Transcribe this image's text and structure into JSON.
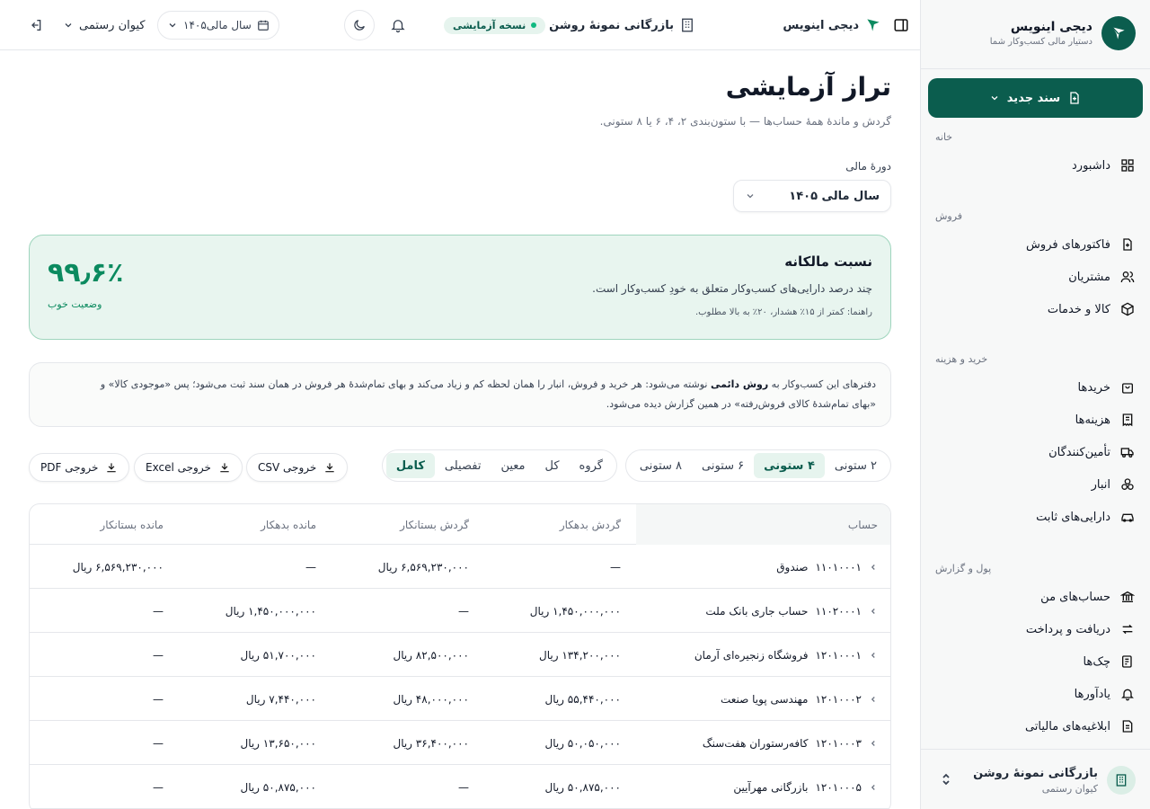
{
  "sidebar": {
    "brand_name": "دیجی اینویس",
    "brand_tagline": "دستیار مالی کسب‌وکار شما",
    "new_doc_label": "سند جدید",
    "sections": [
      {
        "title": "خانه",
        "items": [
          {
            "label": "داشبورد",
            "icon": "grid-icon"
          }
        ]
      },
      {
        "title": "فروش",
        "items": [
          {
            "label": "فاکتورهای فروش",
            "icon": "invoice-icon"
          },
          {
            "label": "مشتریان",
            "icon": "users-icon"
          },
          {
            "label": "کالا و خدمات",
            "icon": "box-icon"
          }
        ]
      },
      {
        "title": "خرید و هزینه",
        "items": [
          {
            "label": "خریدها",
            "icon": "bag-icon"
          },
          {
            "label": "هزینه‌ها",
            "icon": "receipt-icon"
          },
          {
            "label": "تأمین‌کنندگان",
            "icon": "truck-icon"
          },
          {
            "label": "انبار",
            "icon": "boxes-icon"
          },
          {
            "label": "دارایی‌های ثابت",
            "icon": "car-icon"
          }
        ]
      },
      {
        "title": "پول و گزارش",
        "items": [
          {
            "label": "حساب‌های من",
            "icon": "bank-icon"
          },
          {
            "label": "دریافت و پرداخت",
            "icon": "arrows-icon"
          },
          {
            "label": "چک‌ها",
            "icon": "cheque-icon"
          },
          {
            "label": "یادآورها",
            "icon": "bell-icon"
          },
          {
            "label": "ابلاغیه‌های مالیاتی",
            "icon": "mail-icon"
          }
        ]
      }
    ],
    "org_name": "بازرگانی نمونهٔ روشن",
    "org_user": "کیوان رستمی"
  },
  "topbar": {
    "app_name": "دیجی اینویس",
    "company": "بازرگانی نمونهٔ روشن",
    "trial_badge": "نسخه آزمایشی",
    "year": "سال مالی۱۴۰۵",
    "user": "کیوان رستمی"
  },
  "page": {
    "title": "تراز آزمایشی",
    "subtitle": "گردش و ماندهٔ همهٔ حساب‌ها — با ستون‌بندی ۲، ۴، ۶ یا ۸ ستونی.",
    "period_label": "دورهٔ مالی",
    "period_value": "سال مالی ۱۴۰۵"
  },
  "ratio_card": {
    "title": "نسبت مالکانه",
    "description": "چند درصد دارایی‌های کسب‌وکار متعلق به خودِ کسب‌وکار است.",
    "hint": "راهنما: کمتر از ۱۵٪ هشدار، ۲۰٪ به بالا مطلوب.",
    "value": "۹۹٫۶٪",
    "status": "وضعیت خوب"
  },
  "note": {
    "part1": "دفترهای این کسب‌وکار به ",
    "bold": "روش دائمی",
    "part2": " نوشته می‌شود: هر خرید و فروش، انبار را همان لحظه کم و زیاد می‌کند و بهای تمام‌شدهٔ هر فروش در همان سند ثبت می‌شود؛ پس «موجودی کالا» و",
    "line2": "«بهای تمام‌شدهٔ کالای فروش‌رفته» در همین گزارش دیده می‌شود."
  },
  "column_modes": [
    {
      "label": "۲ ستونی",
      "active": false
    },
    {
      "label": "۴ ستونی",
      "active": true
    },
    {
      "label": "۶ ستونی",
      "active": false
    },
    {
      "label": "۸ ستونی",
      "active": false
    }
  ],
  "levels": [
    {
      "label": "گروه",
      "active": false
    },
    {
      "label": "کل",
      "active": false
    },
    {
      "label": "معین",
      "active": false
    },
    {
      "label": "تفصیلی",
      "active": false
    },
    {
      "label": "کامل",
      "active": true
    }
  ],
  "exports": {
    "csv": "خروجی CSV",
    "excel": "خروجی Excel",
    "pdf": "خروجی PDF"
  },
  "table": {
    "headers": [
      "حساب",
      "گردش بدهکار",
      "گردش بستانکار",
      "مانده بدهکار",
      "مانده بستانکار"
    ],
    "rows": [
      {
        "code": "۱۱۰۱۰۰۰۱",
        "name": "صندوق",
        "debit_turnover": "—",
        "credit_turnover": "۶,۵۶۹,۲۳۰,۰۰۰ ریال",
        "debit_balance": "—",
        "credit_balance": "۶,۵۶۹,۲۳۰,۰۰۰ ریال"
      },
      {
        "code": "۱۱۰۲۰۰۰۱",
        "name": "حساب جاری بانک ملت",
        "debit_turnover": "۱,۴۵۰,۰۰۰,۰۰۰ ریال",
        "credit_turnover": "—",
        "debit_balance": "۱,۴۵۰,۰۰۰,۰۰۰ ریال",
        "credit_balance": "—"
      },
      {
        "code": "۱۲۰۱۰۰۰۱",
        "name": "فروشگاه زنجیره‌ای آرمان",
        "debit_turnover": "۱۳۴,۲۰۰,۰۰۰ ریال",
        "credit_turnover": "۸۲,۵۰۰,۰۰۰ ریال",
        "debit_balance": "۵۱,۷۰۰,۰۰۰ ریال",
        "credit_balance": "—"
      },
      {
        "code": "۱۲۰۱۰۰۰۲",
        "name": "مهندسی پویا صنعت",
        "debit_turnover": "۵۵,۴۴۰,۰۰۰ ریال",
        "credit_turnover": "۴۸,۰۰۰,۰۰۰ ریال",
        "debit_balance": "۷,۴۴۰,۰۰۰ ریال",
        "credit_balance": "—"
      },
      {
        "code": "۱۲۰۱۰۰۰۳",
        "name": "کافه‌رستوران هفت‌سنگ",
        "debit_turnover": "۵۰,۰۵۰,۰۰۰ ریال",
        "credit_turnover": "۳۶,۴۰۰,۰۰۰ ریال",
        "debit_balance": "۱۳,۶۵۰,۰۰۰ ریال",
        "credit_balance": "—"
      },
      {
        "code": "۱۲۰۱۰۰۰۵",
        "name": "بازرگانی مهرآیین",
        "debit_turnover": "۵۰,۸۷۵,۰۰۰ ریال",
        "credit_turnover": "—",
        "debit_balance": "۵۰,۸۷۵,۰۰۰ ریال",
        "credit_balance": "—"
      }
    ]
  },
  "colors": {
    "brand": "#0b5d4e",
    "accent": "#0b8a5f",
    "card_bg": "#e8f5ef"
  }
}
